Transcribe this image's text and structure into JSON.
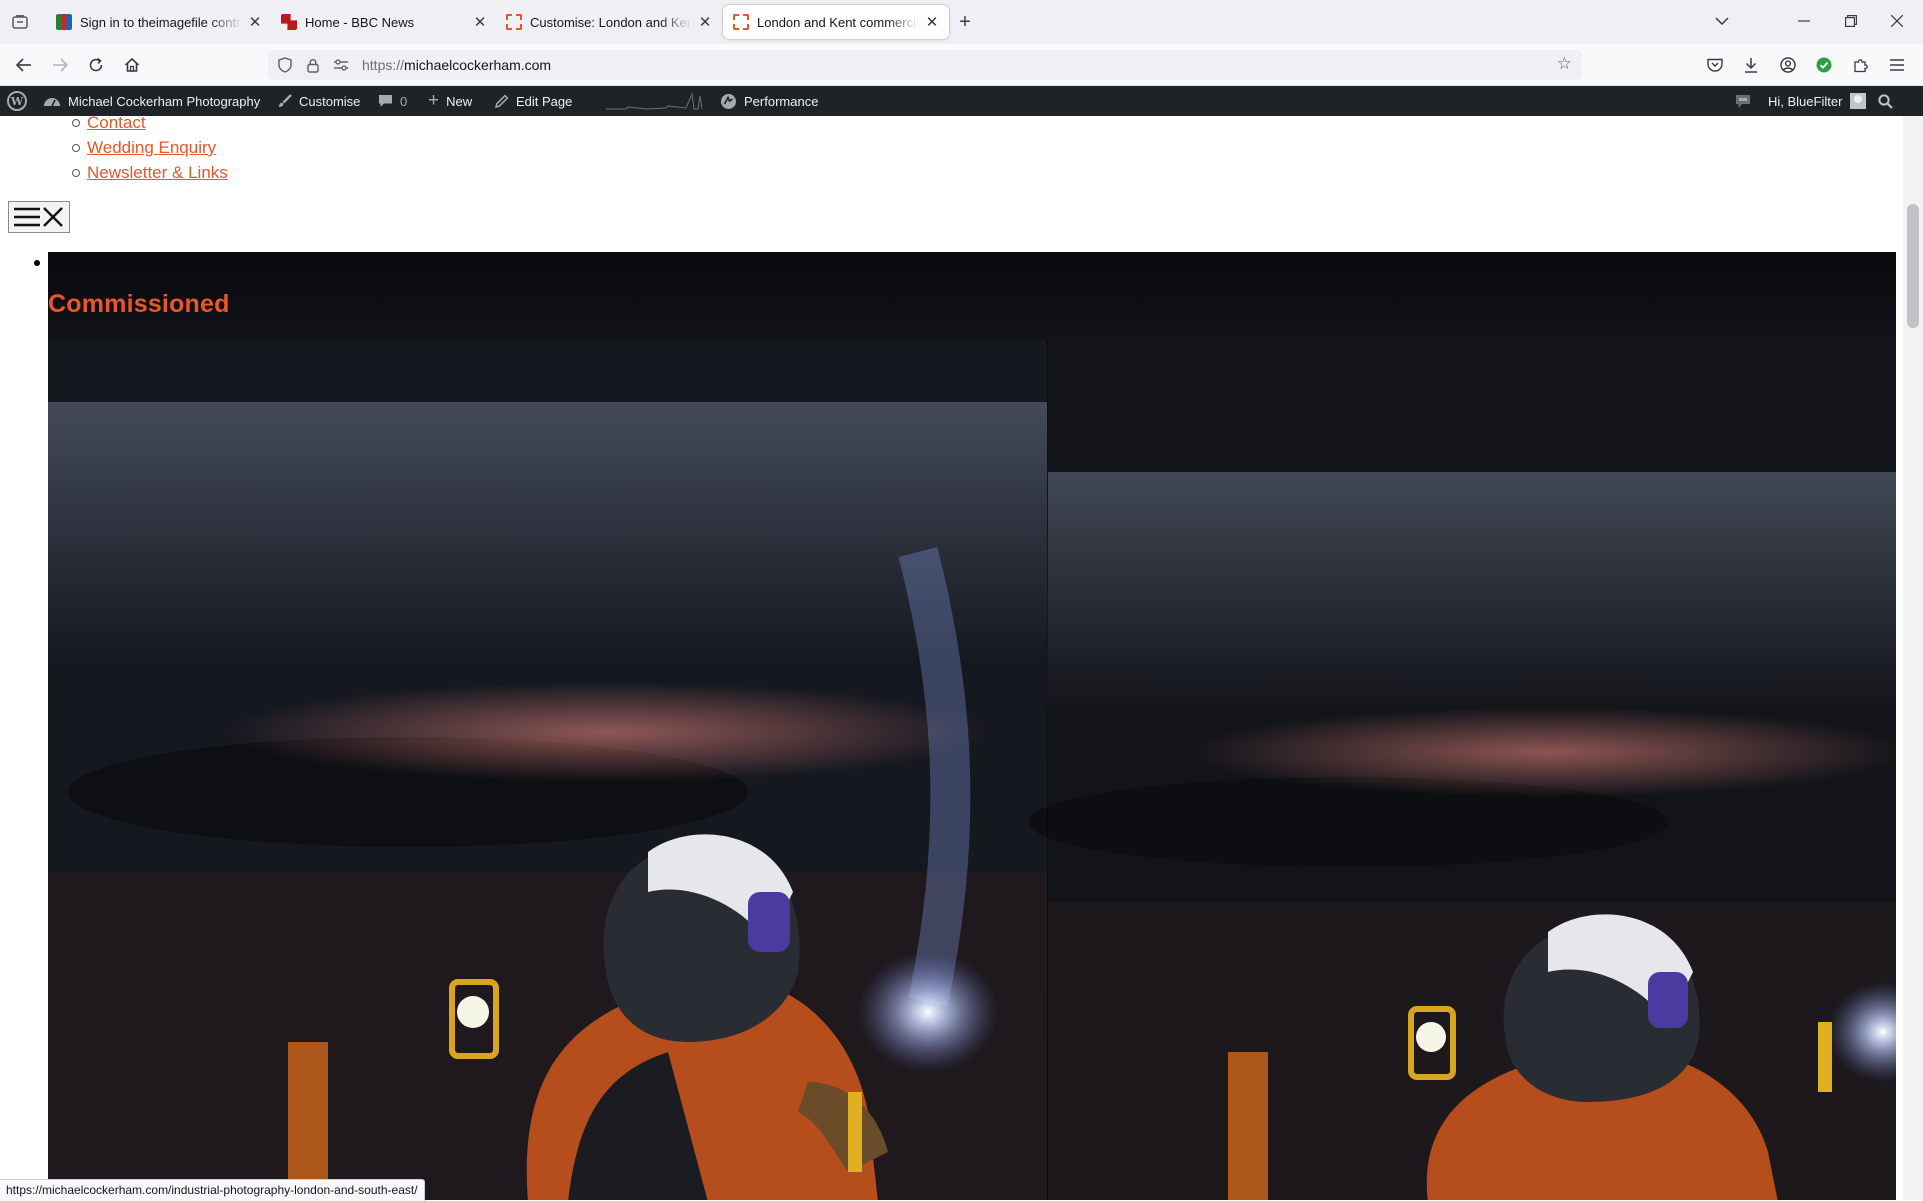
{
  "browser": {
    "tabs": [
      {
        "title": "Sign in to theimagefile control panel",
        "favicon": "imagefile-icon",
        "active": false
      },
      {
        "title": "Home - BBC News",
        "favicon": "bbc-icon",
        "active": false
      },
      {
        "title": "Customise: London and Kent commercial",
        "favicon": "loading-icon",
        "active": false
      },
      {
        "title": "London and Kent commercial and industrial",
        "favicon": "loading-icon",
        "active": true
      }
    ],
    "url_scheme": "https://",
    "url_host": "michaelcockerham.com",
    "status_url": "https://michaelcockerham.com/industrial-photography-london-and-south-east/"
  },
  "wp_admin_bar": {
    "site_name": "Michael Cockerham Photography",
    "customise": "Customise",
    "comments_count": "0",
    "new": "New",
    "edit_page": "Edit Page",
    "performance": "Performance",
    "greeting": "Hi, BlueFilter"
  },
  "page": {
    "submenu": [
      "Contact",
      "Wedding Enquiry",
      "Newsletter & Links"
    ],
    "hero_title": "Commissioned",
    "accent_color": "#e8562a"
  },
  "icons": {
    "menu_toggle": [
      "hamburger-icon",
      "close-icon"
    ]
  }
}
